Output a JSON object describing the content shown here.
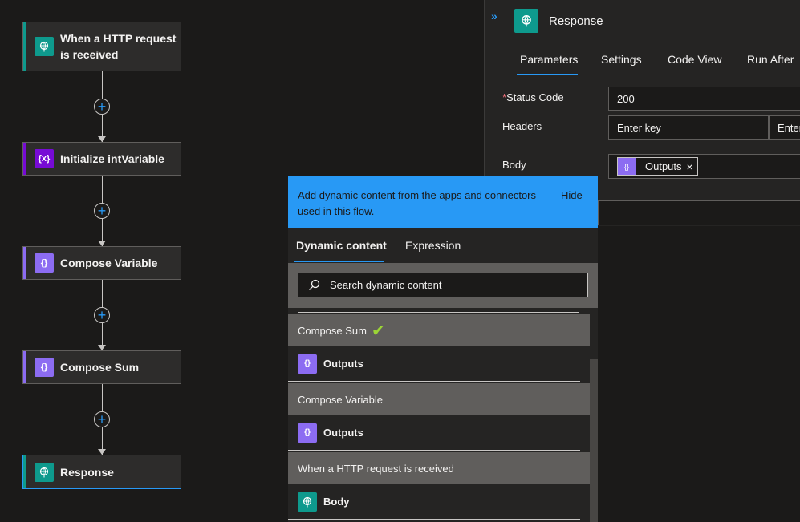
{
  "flow": {
    "cards": [
      {
        "line1": "When a HTTP request",
        "line2": "is received"
      },
      {
        "label": "Initialize intVariable"
      },
      {
        "label": "Compose Variable"
      },
      {
        "label": "Compose Sum"
      },
      {
        "label": "Response"
      }
    ]
  },
  "panel": {
    "title": "Response",
    "tabs": [
      "Parameters",
      "Settings",
      "Code View",
      "Run After"
    ],
    "status_code_label": "Status Code",
    "status_code_asterisk": "*",
    "status_code_value": "200",
    "headers_label": "Headers",
    "headers_key_placeholder": "Enter key",
    "headers_value_placeholder": "Enter",
    "body_label": "Body",
    "body_token": "Outputs",
    "body_token_remove": "×"
  },
  "popup": {
    "header_text": "Add dynamic content from the apps and connectors used in this flow.",
    "hide_label": "Hide",
    "tabs": [
      "Dynamic content",
      "Expression"
    ],
    "search_placeholder": "Search dynamic content",
    "sections": [
      {
        "title": "Compose Sum",
        "check": "✔",
        "item": "Outputs"
      },
      {
        "title": "Compose Variable",
        "item": "Outputs"
      },
      {
        "title": "When a HTTP request is received",
        "item": "Body"
      }
    ]
  },
  "icons": {
    "http": "globe-icon",
    "variable": "braces-x-icon",
    "compose": "braces-icon"
  },
  "colors": {
    "accent_blue": "#2899f5",
    "teal": "#0e9a8d",
    "purple": "#8c6cf2",
    "deep_purple": "#770bd6",
    "check_green": "#9bd436"
  }
}
